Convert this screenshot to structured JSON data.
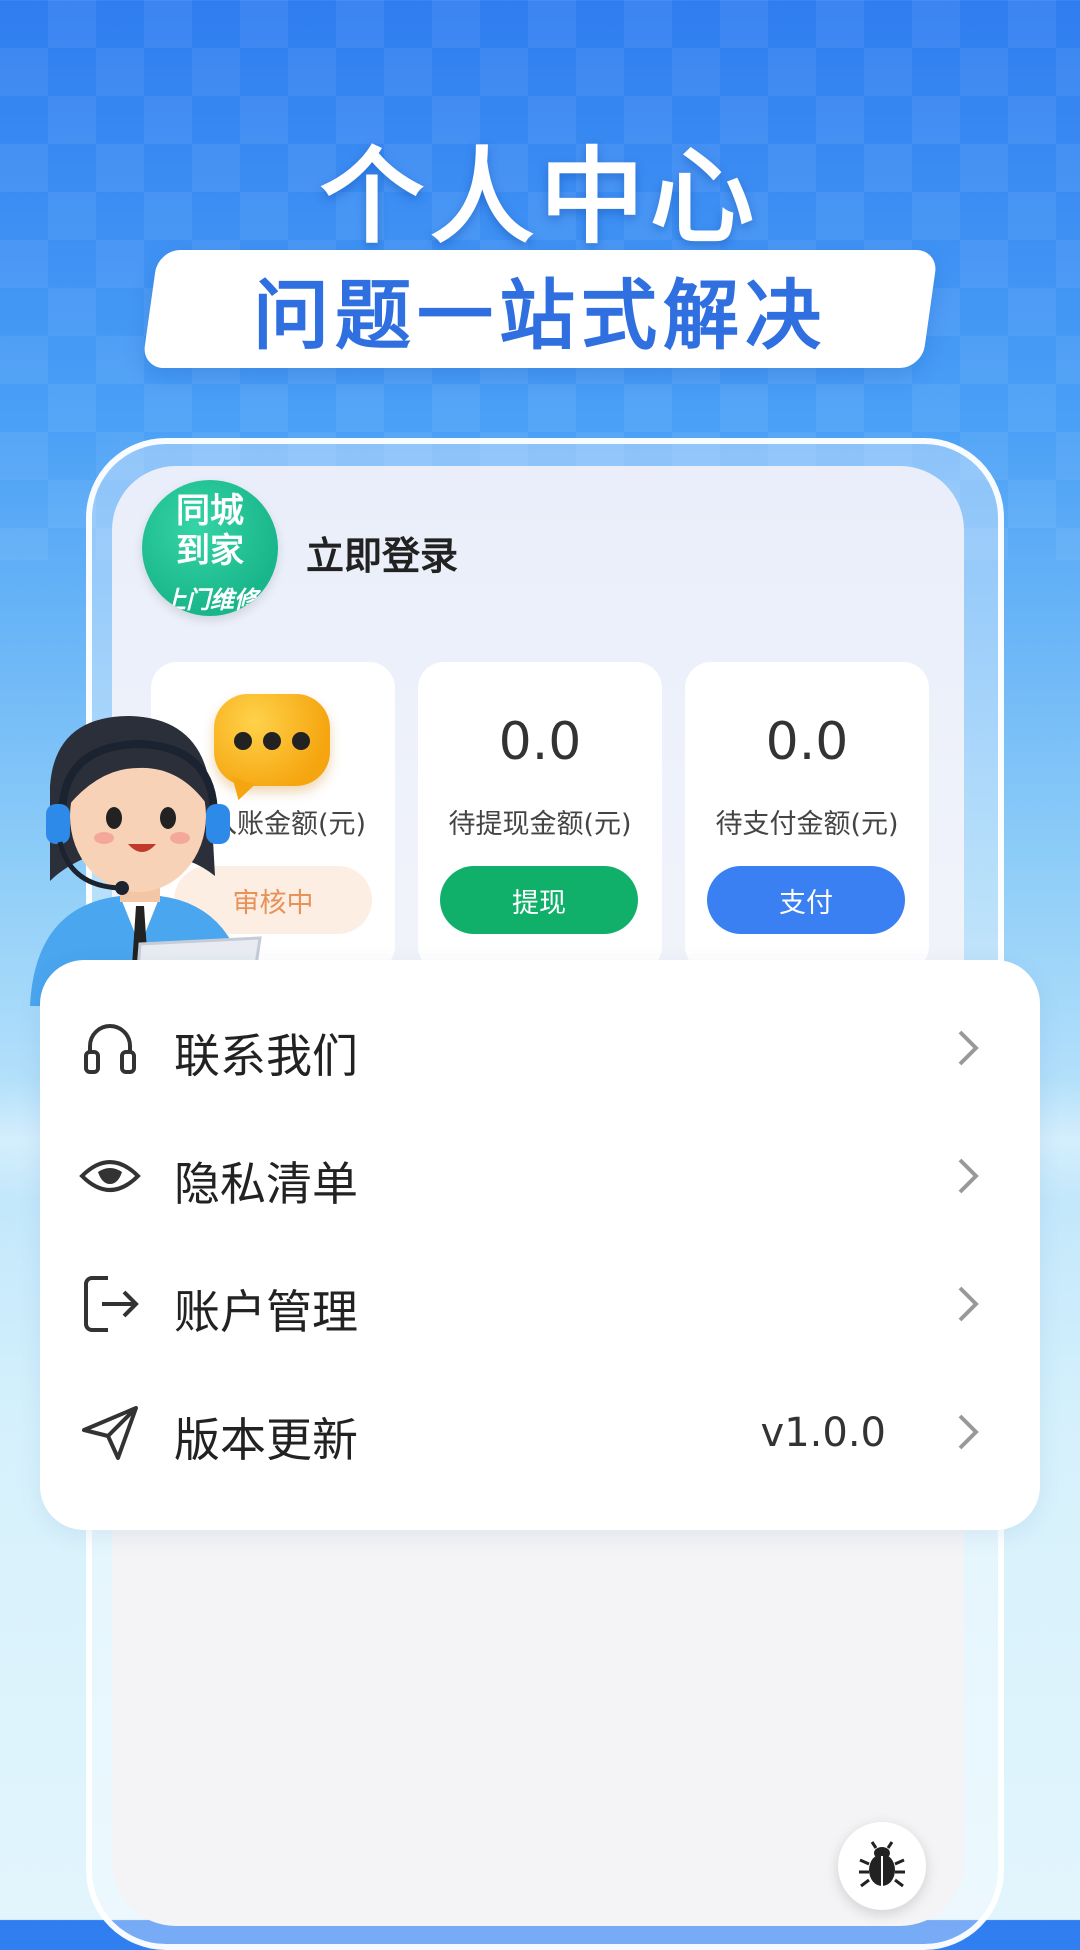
{
  "hero": {
    "title": "个人中心",
    "subtitle": "问题一站式解决"
  },
  "profile": {
    "logo_line1": "同城",
    "logo_line2": "到家",
    "logo_line3": "上门维修",
    "login_label": "立即登录"
  },
  "stats": [
    {
      "label": "入账金额(元)",
      "button": "审核中",
      "button_color": "#fdeee3"
    },
    {
      "value": "0.0",
      "label": "待提现金额(元)",
      "button": "提现",
      "button_color": "#10b06a"
    },
    {
      "value": "0.0",
      "label": "待支付金额(元)",
      "button": "支付",
      "button_color": "#3a80f2"
    }
  ],
  "menu": {
    "items": [
      {
        "label": "联系我们",
        "icon": "headset-icon"
      },
      {
        "label": "隐私清单",
        "icon": "eye-icon"
      },
      {
        "label": "账户管理",
        "icon": "logout-icon"
      },
      {
        "label": "版本更新",
        "icon": "send-icon",
        "value": "v1.0.0"
      }
    ]
  },
  "colors": {
    "accent_blue": "#3a80f2",
    "accent_green": "#10b06a",
    "title_blue": "#2f6fe0"
  }
}
